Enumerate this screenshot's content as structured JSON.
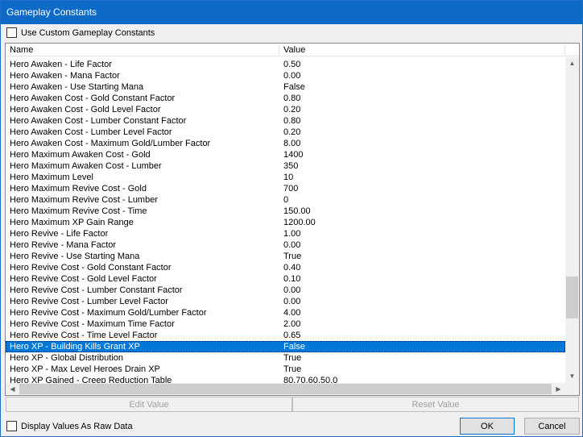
{
  "window": {
    "title": "Gameplay Constants"
  },
  "use_custom": {
    "label": "Use Custom Gameplay Constants",
    "checked": false
  },
  "columns": {
    "name": "Name",
    "value": "Value"
  },
  "rows": [
    {
      "name": "Hero Awaken - Life Factor",
      "value": "0.50"
    },
    {
      "name": "Hero Awaken - Mana Factor",
      "value": "0.00"
    },
    {
      "name": "Hero Awaken - Use Starting Mana",
      "value": "False"
    },
    {
      "name": "Hero Awaken Cost - Gold Constant Factor",
      "value": "0.80"
    },
    {
      "name": "Hero Awaken Cost - Gold Level Factor",
      "value": "0.20"
    },
    {
      "name": "Hero Awaken Cost - Lumber Constant Factor",
      "value": "0.80"
    },
    {
      "name": "Hero Awaken Cost - Lumber Level Factor",
      "value": "0.20"
    },
    {
      "name": "Hero Awaken Cost - Maximum Gold/Lumber Factor",
      "value": "8.00"
    },
    {
      "name": "Hero Maximum Awaken Cost - Gold",
      "value": "1400"
    },
    {
      "name": "Hero Maximum Awaken Cost - Lumber",
      "value": "350"
    },
    {
      "name": "Hero Maximum Level",
      "value": "10"
    },
    {
      "name": "Hero Maximum Revive Cost - Gold",
      "value": "700"
    },
    {
      "name": "Hero Maximum Revive Cost - Lumber",
      "value": "0"
    },
    {
      "name": "Hero Maximum Revive Cost - Time",
      "value": "150.00"
    },
    {
      "name": "Hero Maximum XP Gain Range",
      "value": "1200.00"
    },
    {
      "name": "Hero Revive - Life Factor",
      "value": "1.00"
    },
    {
      "name": "Hero Revive - Mana Factor",
      "value": "0.00"
    },
    {
      "name": "Hero Revive - Use Starting Mana",
      "value": "True"
    },
    {
      "name": "Hero Revive Cost - Gold Constant Factor",
      "value": "0.40"
    },
    {
      "name": "Hero Revive Cost - Gold Level Factor",
      "value": "0.10"
    },
    {
      "name": "Hero Revive Cost - Lumber Constant Factor",
      "value": "0.00"
    },
    {
      "name": "Hero Revive Cost - Lumber Level Factor",
      "value": "0.00"
    },
    {
      "name": "Hero Revive Cost - Maximum Gold/Lumber Factor",
      "value": "4.00"
    },
    {
      "name": "Hero Revive Cost - Maximum Time Factor",
      "value": "2.00"
    },
    {
      "name": "Hero Revive Cost - Time Level Factor",
      "value": "0.65"
    },
    {
      "name": "Hero XP - Building Kills Grant XP",
      "value": "False",
      "selected": true
    },
    {
      "name": "Hero XP - Global Distribution",
      "value": "True"
    },
    {
      "name": "Hero XP - Max Level Heroes Drain XP",
      "value": "True"
    },
    {
      "name": "Hero XP Gained - Creep Reduction Table",
      "value": "80,70,60,50,0"
    }
  ],
  "buttons": {
    "edit": "Edit Value",
    "reset": "Reset Value",
    "ok": "OK",
    "cancel": "Cancel"
  },
  "raw_data": {
    "label": "Display Values As Raw Data",
    "checked": false
  },
  "colors": {
    "titlebar": "#0d6bc7",
    "selection": "#0078d7"
  }
}
